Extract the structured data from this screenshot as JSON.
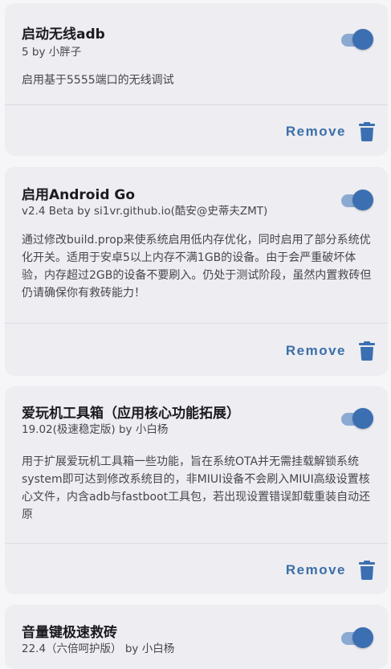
{
  "colors": {
    "accent": "#3b6fb2",
    "toggle_track": "#8aaad3",
    "card_bg": "#eeedf1",
    "page_bg": "#f6f5f8",
    "remove_text": "#3b6fa8"
  },
  "modules": [
    {
      "title": "启动无线adb",
      "meta": "5 by 小胖子",
      "description": "启用基于5555端口的无线调试",
      "enabled": true,
      "remove_label": "Remove",
      "remove_icon": "trash-icon"
    },
    {
      "title": "启用Android Go",
      "meta": "v2.4 Beta by si1vr.github.io(酷安@史蒂夫ZMT)",
      "description": "通过修改build.prop来使系统启用低内存优化，同时启用了部分系统优化开关。适用于安卓5以上内存不满1GB的设备。由于会严重破坏体验，内存超过2GB的设备不要刷入。仍处于测试阶段，虽然内置救砖但仍请确保你有救砖能力！",
      "enabled": true,
      "remove_label": "Remove",
      "remove_icon": "trash-icon"
    },
    {
      "title": "爱玩机工具箱（应用核心功能拓展）",
      "meta": "19.02(极速稳定版) by 小白杨",
      "description": "用于扩展爱玩机工具箱一些功能，旨在系统OTA并无需挂载解锁系统system即可达到修改系统目的，非MIUI设备不会刷入MIUI高级设置核心文件，内含adb与fastboot工具包，若出现设置错误卸载重装自动还原",
      "enabled": true,
      "remove_label": "Remove",
      "remove_icon": "trash-icon"
    },
    {
      "title": "音量键极速救砖",
      "meta": "22.4（六倍呵护版） by 小白杨",
      "enabled": true
    }
  ]
}
